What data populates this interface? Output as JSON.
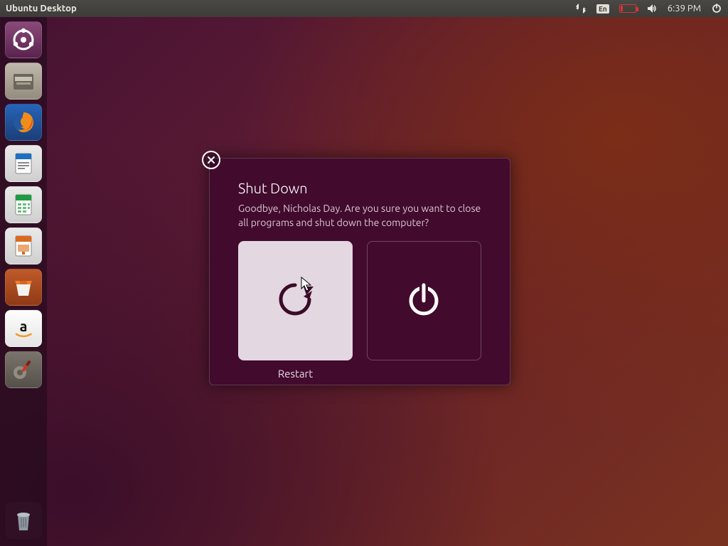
{
  "menubar": {
    "title": "Ubuntu Desktop",
    "keyboard": "En",
    "time": "6:39 PM"
  },
  "launcher": {
    "items": [
      {
        "name": "dash"
      },
      {
        "name": "files"
      },
      {
        "name": "firefox"
      },
      {
        "name": "writer"
      },
      {
        "name": "calc"
      },
      {
        "name": "impress"
      },
      {
        "name": "software"
      },
      {
        "name": "amazon"
      },
      {
        "name": "settings"
      }
    ],
    "trash": "trash"
  },
  "dialog": {
    "title": "Shut Down",
    "message": "Goodbye, Nicholas Day. Are you sure you want to close all programs and shut down the computer?",
    "restart_label": "Restart",
    "shutdown_label": ""
  }
}
